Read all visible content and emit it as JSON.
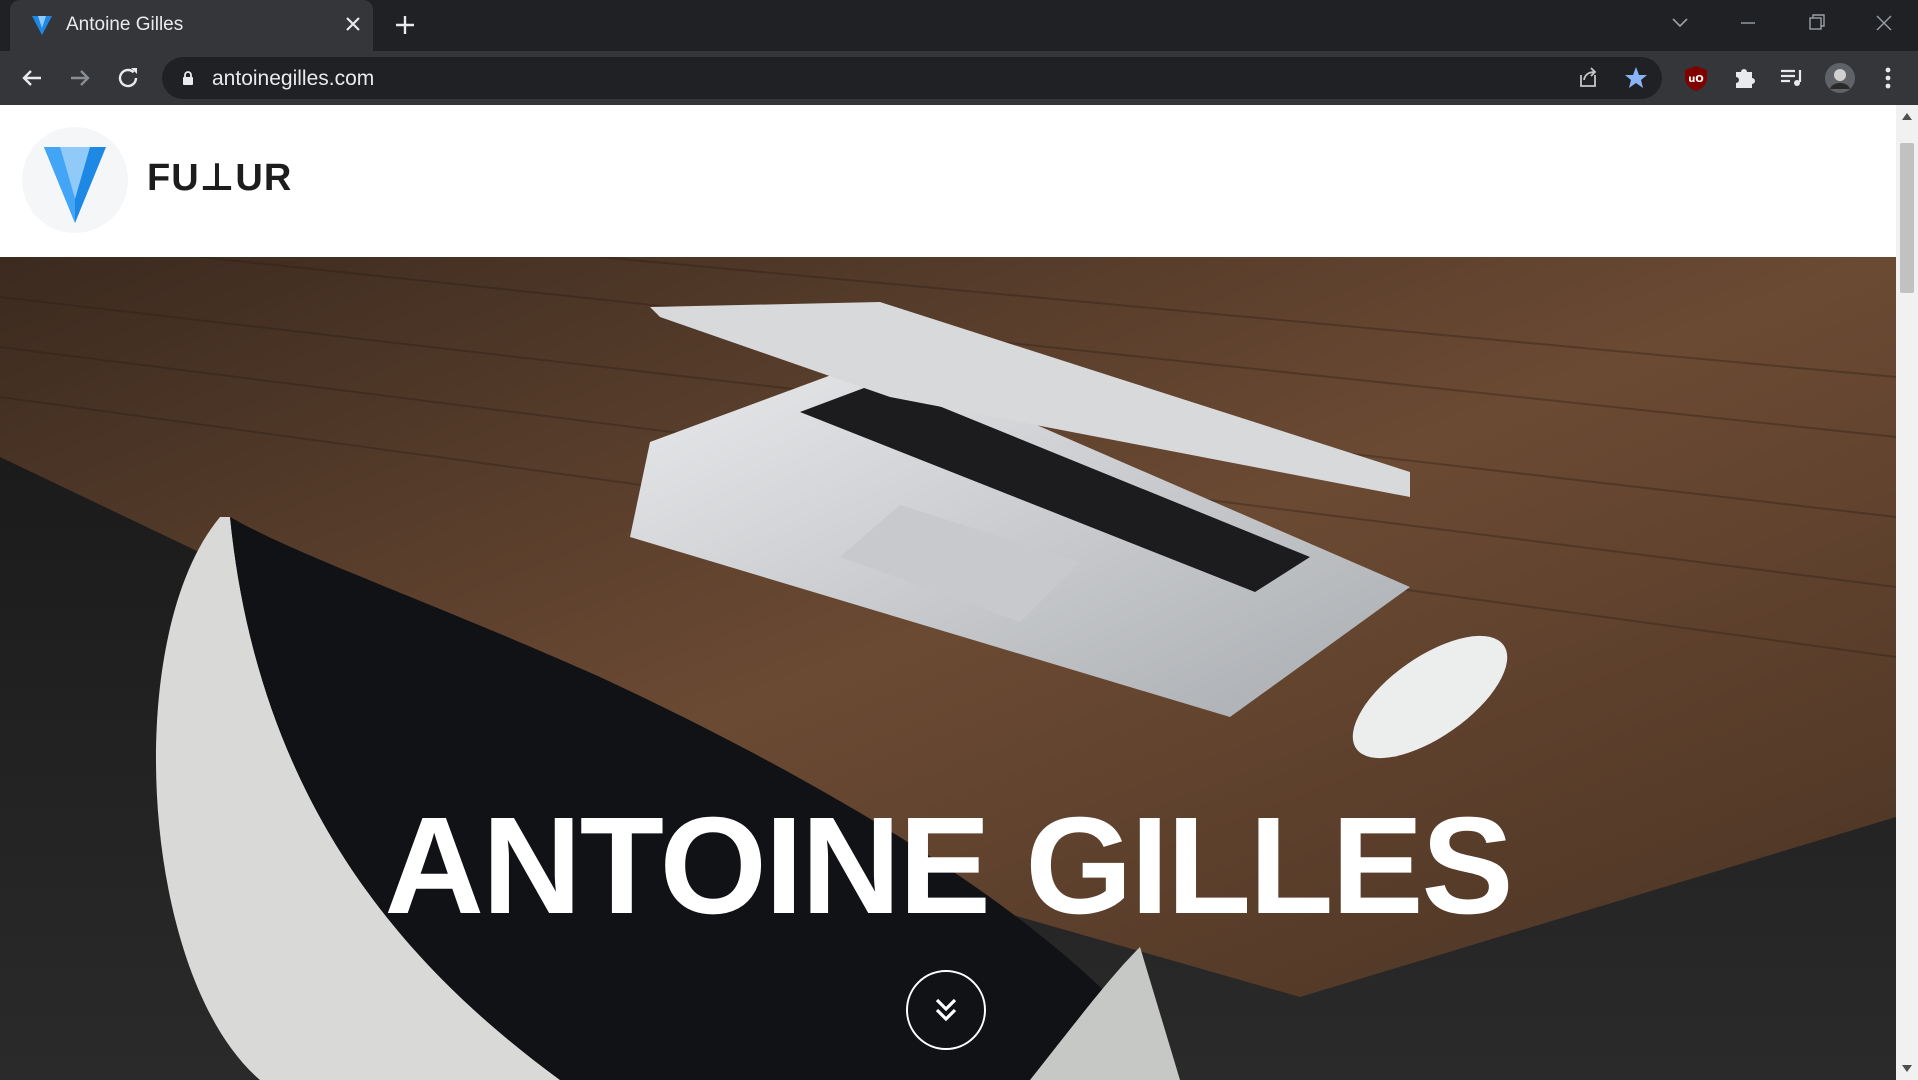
{
  "browser": {
    "tab_title": "Antoine Gilles",
    "url": "antoinegilles.com",
    "tab_icons": {
      "favicon": "vuetify-v-icon",
      "close": "close-icon",
      "new_tab": "plus-icon"
    },
    "window_icons": [
      "tab-search-icon",
      "minimize-icon",
      "restore-icon",
      "close-window-icon"
    ],
    "toolbar_icons": [
      "back-icon",
      "forward-icon",
      "reload-icon",
      "lock-icon",
      "share-icon",
      "bookmark-star-icon",
      "ublock-icon",
      "extensions-puzzle-icon",
      "media-queue-icon",
      "profile-avatar",
      "menu-dots-icon"
    ]
  },
  "site": {
    "brand": "FU⊥UR",
    "hero_title": "ANTOINE GILLES",
    "scroll_button_icon": "double-chevron-down-icon"
  },
  "colors": {
    "frame": "#202124",
    "toolbar": "#35363a",
    "accent_star": "#8ab4f8",
    "logo_blue_dark": "#1e88e5",
    "logo_blue_light": "#90caf9",
    "hero_text": "#ffffff"
  }
}
